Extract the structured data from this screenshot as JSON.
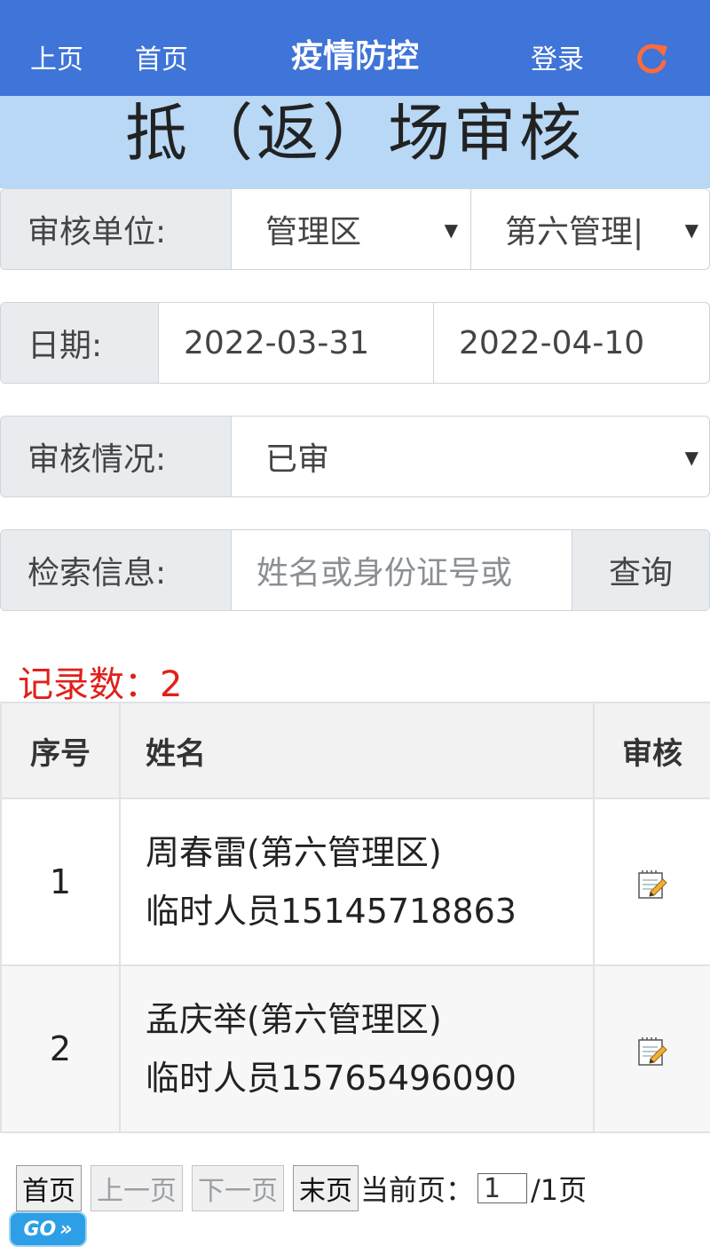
{
  "topbar": {
    "prev_label": "上页",
    "home_label": "首页",
    "title": "疫情防控",
    "login_label": "登录",
    "refresh_icon": "refresh-icon",
    "refresh_color": "#ff6a3d",
    "bg_color": "#3f74d8"
  },
  "page_heading": "抵（返）场审核",
  "filters": {
    "unit": {
      "label": "审核单位:",
      "select1": "管理区",
      "select2": "第六管理|"
    },
    "date": {
      "label": "日期:",
      "start": "2022-03-31",
      "end": "2022-04-10"
    },
    "status": {
      "label": "审核情况:",
      "value": "已审"
    },
    "search": {
      "label": "检索信息:",
      "placeholder": "姓名或身份证号或",
      "button": "查询"
    }
  },
  "record_count": "记录数：2",
  "table": {
    "headers": [
      "序号",
      "姓名",
      "审核"
    ],
    "rows": [
      {
        "index": "1",
        "name": "周春雷(第六管理区)",
        "detail": "临时人员15145718863"
      },
      {
        "index": "2",
        "name": "孟庆举(第六管理区)",
        "detail": "临时人员15765496090"
      }
    ]
  },
  "pager": {
    "first": "首页",
    "prev": "上一页",
    "next": "下一页",
    "last": "末页",
    "current_label": "当前页：",
    "current_value": "1",
    "total": "/1页",
    "go": "GO"
  }
}
